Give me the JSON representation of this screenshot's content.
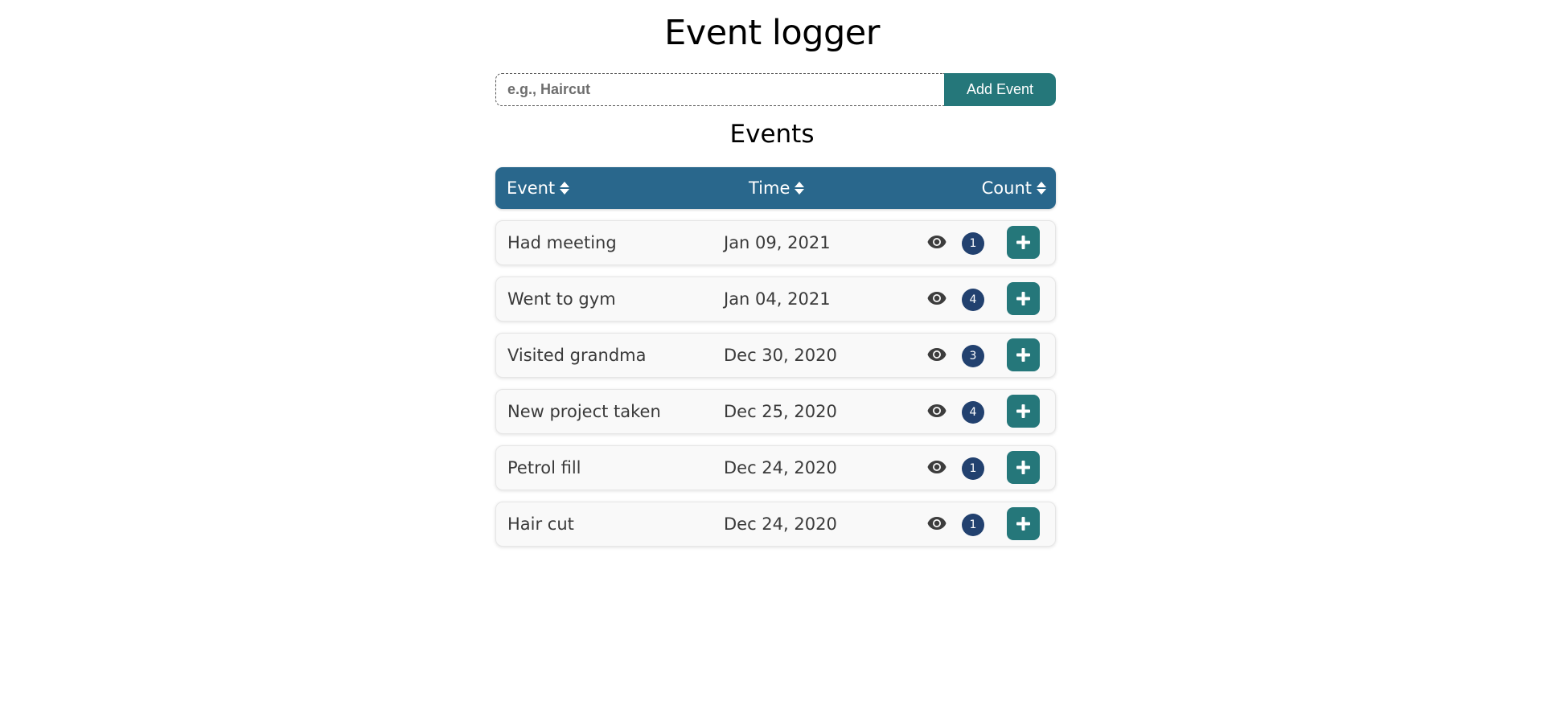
{
  "app": {
    "title": "Event logger"
  },
  "form": {
    "input_placeholder": "e.g., Haircut",
    "input_value": "",
    "add_label": "Add Event"
  },
  "events_section": {
    "title": "Events",
    "columns": {
      "event": "Event",
      "time": "Time",
      "count": "Count"
    },
    "rows": [
      {
        "event": "Had meeting",
        "time": "Jan 09, 2021",
        "count": "1"
      },
      {
        "event": "Went to gym",
        "time": "Jan 04, 2021",
        "count": "4"
      },
      {
        "event": "Visited grandma",
        "time": "Dec 30, 2020",
        "count": "3"
      },
      {
        "event": "New project taken",
        "time": "Dec 25, 2020",
        "count": "4"
      },
      {
        "event": "Petrol fill",
        "time": "Dec 24, 2020",
        "count": "1"
      },
      {
        "event": "Hair cut",
        "time": "Dec 24, 2020",
        "count": "1"
      }
    ]
  },
  "icons": {
    "sort": "sort-icon",
    "view": "eye-icon",
    "increment": "plus-icon"
  },
  "colors": {
    "header_bg": "#29678c",
    "accent": "#25777a",
    "badge_bg": "#22416f",
    "row_bg": "#f9f9f9",
    "text": "#3a3a3a"
  }
}
